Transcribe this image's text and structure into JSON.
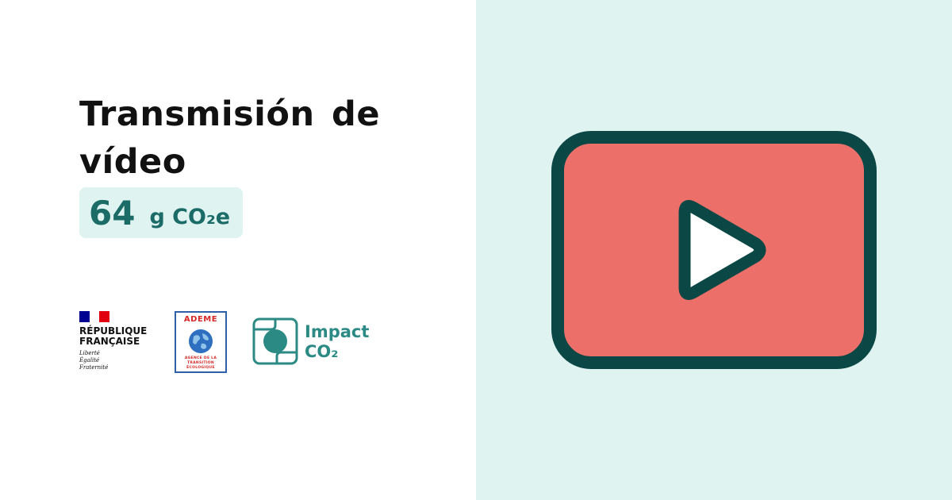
{
  "card": {
    "title": "Transmisión de vídeo",
    "value": "64",
    "unit": "g CO₂e"
  },
  "logos": {
    "republique": {
      "name_line1": "RÉPUBLIQUE",
      "name_line2": "FRANÇAISE",
      "motto_line1": "Liberté",
      "motto_line2": "Égalité",
      "motto_line3": "Fraternité"
    },
    "ademe": {
      "name": "ADEME",
      "subtitle_line1": "AGENCE DE LA",
      "subtitle_line2": "TRANSITION",
      "subtitle_line3": "ÉCOLOGIQUE"
    },
    "impact": {
      "line1": "Impact",
      "line2": "CO₂"
    }
  },
  "icon": {
    "name": "video-play-icon"
  },
  "colors": {
    "accent_bg": "#dff3f1",
    "value_text": "#1b6b67",
    "video_fill": "#ec6f6a",
    "video_stroke": "#0b4845",
    "impact_teal": "#2b8a84",
    "flag_blue": "#000091",
    "flag_red": "#e1000f",
    "ademe_red": "#d62828",
    "ademe_blue": "#2f5fa7"
  }
}
